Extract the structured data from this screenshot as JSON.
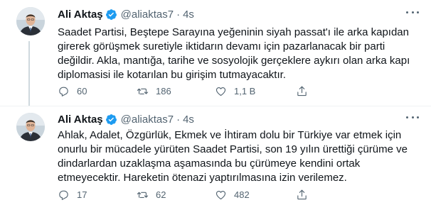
{
  "tweets": [
    {
      "author": "Ali Aktaş",
      "handle": "@aliaktas7",
      "separator": "·",
      "time": "4s",
      "lines": [
        "Saadet Partisi, Beştepe Sarayına yeğeninin siyah passat'ı ile arka kapıdan",
        "girerek görüşmek suretiyle iktidarın devamı için pazarlanacak bir parti",
        "değildir. Akla, mantığa, tarihe ve sosyolojik gerçeklere aykırı olan arka kapı",
        "diplomasisi ile kotarılan bu girişim tutmayacaktır."
      ],
      "replies": "60",
      "retweets": "186",
      "likes": "1,1 B"
    },
    {
      "author": "Ali Aktaş",
      "handle": "@aliaktas7",
      "separator": "·",
      "time": "4s",
      "lines": [
        "Ahlak, Adalet, Özgürlük, Ekmek ve İhtiram dolu bir Türkiye var etmek için",
        "onurlu bir mücadele yürüten Saadet Partisi, son 19 yılın ürettiği çürüme ve",
        "dindarlardan uzaklaşma aşamasında bu çürümeye kendini ortak",
        "etmeyecektir. Hareketin ötenazi yaptırılmasına izin verilemez."
      ],
      "replies": "17",
      "retweets": "62",
      "likes": "482"
    }
  ],
  "icons": {
    "verified": "verified-badge-icon",
    "more": "more-options-icon",
    "reply": "reply-icon",
    "retweet": "retweet-icon",
    "like": "heart-icon",
    "share": "share-icon"
  },
  "colors": {
    "verified": "#1d9bf0",
    "muted": "#536471",
    "text": "#0f1419",
    "thread_line": "#cfd9de"
  }
}
